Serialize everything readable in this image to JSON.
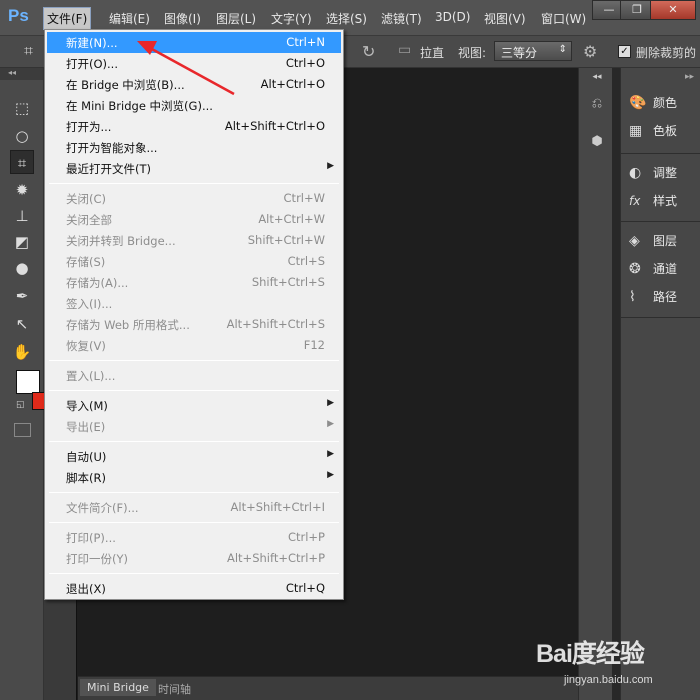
{
  "app": {
    "logo": "Ps"
  },
  "menubar": {
    "items": [
      "文件(F)",
      "编辑(E)",
      "图像(I)",
      "图层(L)",
      "文字(Y)",
      "选择(S)",
      "滤镜(T)",
      "3D(D)",
      "视图(V)",
      "窗口(W)"
    ],
    "active_index": 0
  },
  "window_controls": {
    "minimize": "—",
    "restore": "❐",
    "close": "✕"
  },
  "options_bar": {
    "straighten_label": "拉直",
    "view_label": "视图:",
    "view_value": "三等分",
    "delete_cropped_label": "删除裁剪的",
    "delete_cropped_checked": true
  },
  "file_menu": {
    "items": [
      {
        "label": "新建(N)...",
        "shortcut": "Ctrl+N",
        "enabled": true,
        "highlighted": true
      },
      {
        "label": "打开(O)...",
        "shortcut": "Ctrl+O",
        "enabled": true
      },
      {
        "label": "在 Bridge 中浏览(B)...",
        "shortcut": "Alt+Ctrl+O",
        "enabled": true
      },
      {
        "label": "在 Mini Bridge 中浏览(G)...",
        "shortcut": "",
        "enabled": true
      },
      {
        "label": "打开为...",
        "shortcut": "Alt+Shift+Ctrl+O",
        "enabled": true
      },
      {
        "label": "打开为智能对象...",
        "shortcut": "",
        "enabled": true
      },
      {
        "label": "最近打开文件(T)",
        "shortcut": "",
        "enabled": true,
        "submenu": true
      },
      {
        "separator": true
      },
      {
        "label": "关闭(C)",
        "shortcut": "Ctrl+W",
        "enabled": false
      },
      {
        "label": "关闭全部",
        "shortcut": "Alt+Ctrl+W",
        "enabled": false
      },
      {
        "label": "关闭并转到 Bridge...",
        "shortcut": "Shift+Ctrl+W",
        "enabled": false
      },
      {
        "label": "存储(S)",
        "shortcut": "Ctrl+S",
        "enabled": false
      },
      {
        "label": "存储为(A)...",
        "shortcut": "Shift+Ctrl+S",
        "enabled": false
      },
      {
        "label": "签入(I)...",
        "shortcut": "",
        "enabled": false
      },
      {
        "label": "存储为 Web 所用格式...",
        "shortcut": "Alt+Shift+Ctrl+S",
        "enabled": false
      },
      {
        "label": "恢复(V)",
        "shortcut": "F12",
        "enabled": false
      },
      {
        "separator": true
      },
      {
        "label": "置入(L)...",
        "shortcut": "",
        "enabled": false
      },
      {
        "separator": true
      },
      {
        "label": "导入(M)",
        "shortcut": "",
        "enabled": true,
        "submenu": true
      },
      {
        "label": "导出(E)",
        "shortcut": "",
        "enabled": false,
        "submenu": true
      },
      {
        "separator": true
      },
      {
        "label": "自动(U)",
        "shortcut": "",
        "enabled": true,
        "submenu": true
      },
      {
        "label": "脚本(R)",
        "shortcut": "",
        "enabled": true,
        "submenu": true
      },
      {
        "separator": true
      },
      {
        "label": "文件简介(F)...",
        "shortcut": "Alt+Shift+Ctrl+I",
        "enabled": false
      },
      {
        "separator": true
      },
      {
        "label": "打印(P)...",
        "shortcut": "Ctrl+P",
        "enabled": false
      },
      {
        "label": "打印一份(Y)",
        "shortcut": "Alt+Shift+Ctrl+P",
        "enabled": false
      },
      {
        "separator": true
      },
      {
        "label": "退出(X)",
        "shortcut": "Ctrl+Q",
        "enabled": true
      }
    ]
  },
  "right_panels": {
    "groups": [
      [
        {
          "icon": "palette-icon",
          "glyph": "🎨",
          "label": "颜色"
        },
        {
          "icon": "swatches-icon",
          "glyph": "▦",
          "label": "色板"
        }
      ],
      [
        {
          "icon": "adjustments-icon",
          "glyph": "◐",
          "label": "调整"
        },
        {
          "icon": "fx-icon",
          "glyph": "fx",
          "label": "样式"
        }
      ],
      [
        {
          "icon": "layers-icon",
          "glyph": "◈",
          "label": "图层"
        },
        {
          "icon": "channels-icon",
          "glyph": "❂",
          "label": "通道"
        },
        {
          "icon": "paths-icon",
          "glyph": "⌇",
          "label": "路径"
        }
      ]
    ]
  },
  "bottom_tabs": [
    "Mini Bridge",
    "时间轴"
  ],
  "watermark": {
    "brand": "Bai度经验",
    "url": "jingyan.baidu.com"
  }
}
